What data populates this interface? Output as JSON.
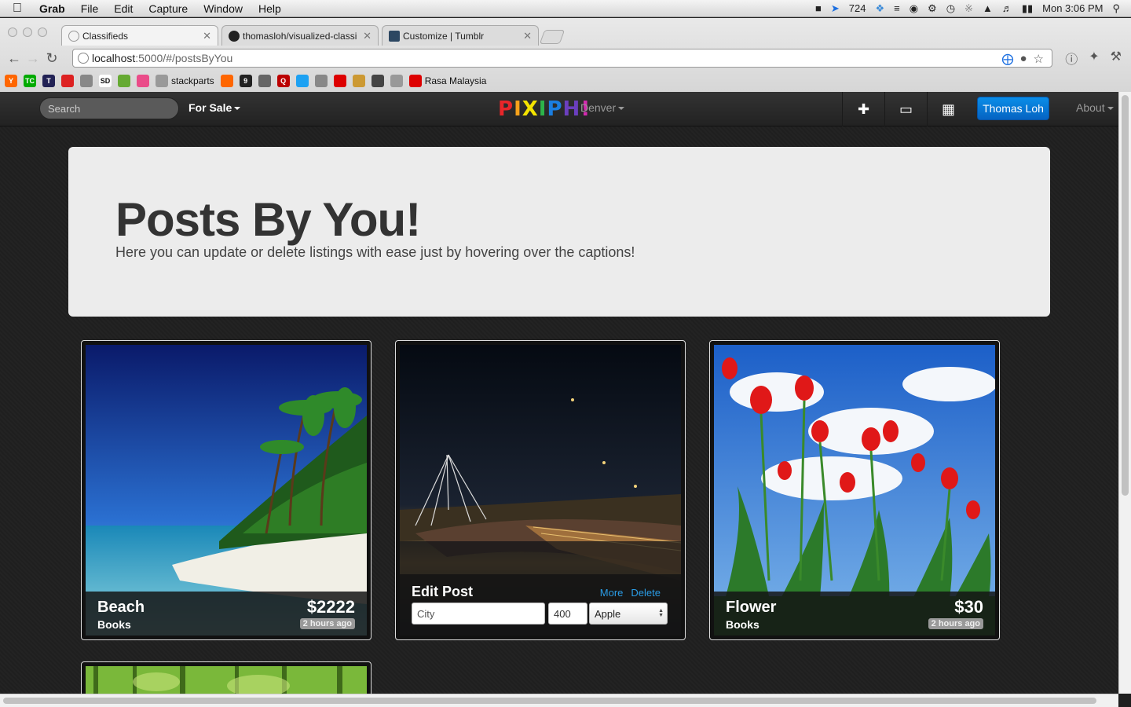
{
  "menubar": {
    "app": "Grab",
    "items": [
      "File",
      "Edit",
      "Capture",
      "Window",
      "Help"
    ],
    "tray_count": "724",
    "clock": "Mon 3:06 PM"
  },
  "browser": {
    "tabs": [
      {
        "label": "Classifieds",
        "active": true
      },
      {
        "label": "thomasloh/visualized-classi",
        "active": false
      },
      {
        "label": "Customize | Tumblr",
        "active": false
      }
    ],
    "url_host": "localhost",
    "url_path": ":5000/#/postsByYou",
    "bookmarks": [
      {
        "label": "",
        "icon": "Y",
        "color": "#f60"
      },
      {
        "label": "",
        "icon": "TC",
        "color": "#0a0"
      },
      {
        "label": "",
        "icon": "T",
        "color": "#225"
      },
      {
        "label": "",
        "icon": "",
        "color": "#d22"
      },
      {
        "label": "",
        "icon": "",
        "color": "#888"
      },
      {
        "label": "",
        "icon": "SD",
        "color": "#fff"
      },
      {
        "label": "",
        "icon": "",
        "color": "#6a3"
      },
      {
        "label": "",
        "icon": "",
        "color": "#ea4c89"
      },
      {
        "label": "stackparts",
        "icon": "",
        "color": "#999"
      },
      {
        "label": "",
        "icon": "",
        "color": "#f60"
      },
      {
        "label": "",
        "icon": "9",
        "color": "#222"
      },
      {
        "label": "",
        "icon": "",
        "color": "#666"
      },
      {
        "label": "",
        "icon": "Q",
        "color": "#b00"
      },
      {
        "label": "",
        "icon": "",
        "color": "#1da1f2"
      },
      {
        "label": "",
        "icon": "",
        "color": "#888"
      },
      {
        "label": "",
        "icon": "",
        "color": "#d00"
      },
      {
        "label": "",
        "icon": "",
        "color": "#c93"
      },
      {
        "label": "",
        "icon": "",
        "color": "#444"
      },
      {
        "label": "",
        "icon": "",
        "color": "#999"
      },
      {
        "label": "Rasa Malaysia",
        "icon": "",
        "color": "#d00"
      }
    ]
  },
  "navbar": {
    "search_placeholder": "Search",
    "category": "For Sale",
    "brand_letters": [
      {
        "char": "P",
        "color": "#e8262a"
      },
      {
        "char": "I",
        "color": "#f7a21b"
      },
      {
        "char": "X",
        "color": "#f5e400"
      },
      {
        "char": "I",
        "color": "#2db34a"
      },
      {
        "char": "P",
        "color": "#1a7ee0"
      },
      {
        "char": "H",
        "color": "#6b3fbf"
      },
      {
        "char": "!",
        "color": "#d42ab0"
      }
    ],
    "city": "Denver",
    "user": "Thomas Loh",
    "about": "About"
  },
  "hero": {
    "title": "Posts By You!",
    "subtitle": "Here you can update or delete listings with ease just by hovering over the captions!"
  },
  "posts": [
    {
      "title": "Beach",
      "category": "Books",
      "price": "$2222",
      "ago": "2 hours ago"
    },
    {
      "edit_title": "Edit Post",
      "more": "More",
      "delete": "Delete",
      "city_placeholder": "City",
      "price_value": "400",
      "category_value": "Apple"
    },
    {
      "title": "Flower",
      "category": "Books",
      "price": "$30",
      "ago": "2 hours ago"
    }
  ]
}
